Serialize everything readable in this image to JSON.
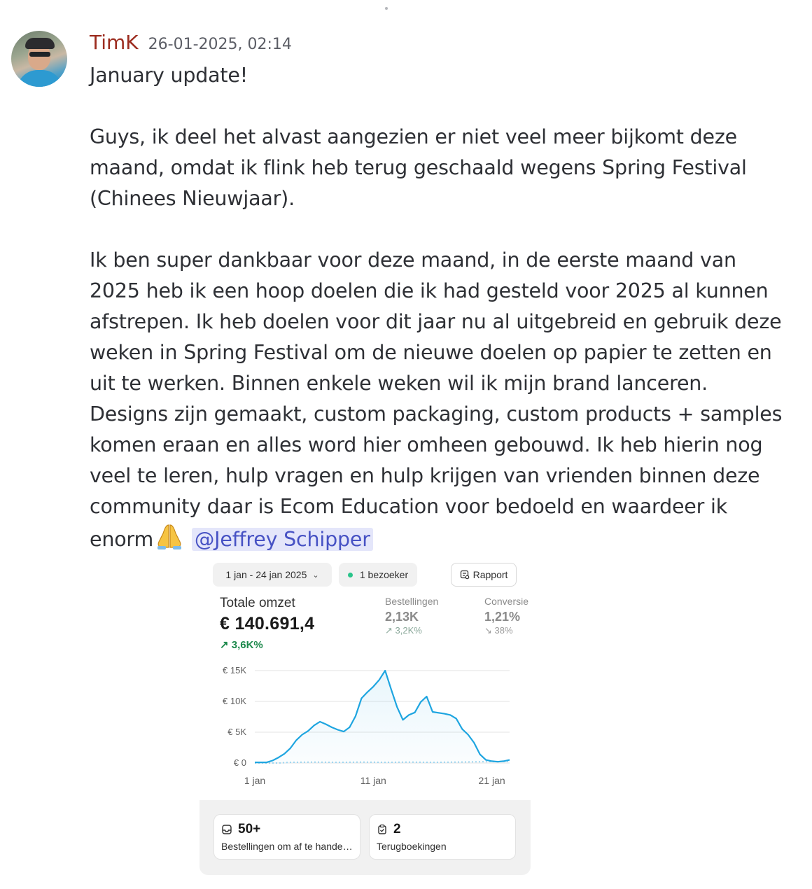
{
  "post": {
    "author": "TimK",
    "timestamp": "26-01-2025, 02:14",
    "paragraphs": {
      "p1": "January update!",
      "p2": "Guys, ik deel het alvast aangezien er niet veel meer bijkomt deze maand, omdat ik flink heb terug geschaald wegens Spring Festival (Chinees Nieuwjaar).",
      "p3": "Ik ben super dankbaar voor deze maand, in de eerste maand van 2025 heb ik een hoop doelen die ik had gesteld voor 2025 al kunnen afstrepen. Ik heb doelen voor dit jaar nu al uitgebreid en gebruik deze weken in Spring Festival om de nieuwe doelen op papier te zetten en uit te werken. Binnen enkele weken wil ik mijn brand lanceren. Designs zijn gemaakt, custom packaging, custom products + samples komen eraan en alles word hier omheen gebouwd. Ik heb hierin nog veel te leren, hulp vragen en hulp krijgen van vrienden binnen deze community daar is Ecom Education voor bedoeld en waardeer ik enorm"
    },
    "emoji": "folded-hands-emoji",
    "mention": "@Jeffrey Schipper",
    "colors": {
      "author": "#9c2c1f",
      "mention_bg": "#e4e6fa",
      "mention_text": "#4752c4"
    }
  },
  "dashboard": {
    "date_range": "1 jan - 24 jan 2025",
    "visitors": "1 bezoeker",
    "report_button": "Rapport",
    "total_sales": {
      "label": "Totale omzet",
      "value": "€ 140.691,4",
      "delta": "3,6K%"
    },
    "orders": {
      "label": "Bestellingen",
      "value": "2,13K",
      "delta": "3,2K%"
    },
    "conversion": {
      "label": "Conversie",
      "value": "1,21%",
      "delta": "38%"
    },
    "cards": {
      "to_fulfill": {
        "count": "50+",
        "label": "Bestellingen om af te handelen"
      },
      "chargebacks": {
        "count": "2",
        "label": "Terugboekingen"
      }
    }
  },
  "chart_data": {
    "type": "line",
    "y_tick_labels": [
      "€ 15K",
      "€ 10K",
      "€ 5K",
      "€ 0"
    ],
    "x_tick_labels": [
      "1 jan",
      "11 jan",
      "21 jan"
    ],
    "ylim": [
      0,
      15000
    ],
    "grid": true,
    "series": [
      {
        "color": "#1ea5e0",
        "values": [
          [
            0,
            100
          ],
          [
            1,
            100
          ],
          [
            1.5,
            400
          ],
          [
            2,
            900
          ],
          [
            2.5,
            1500
          ],
          [
            3,
            2400
          ],
          [
            3.5,
            3700
          ],
          [
            4,
            4600
          ],
          [
            4.5,
            5200
          ],
          [
            5,
            6100
          ],
          [
            5.5,
            6700
          ],
          [
            6,
            6300
          ],
          [
            6.5,
            5800
          ],
          [
            7,
            5400
          ],
          [
            7.5,
            5100
          ],
          [
            8,
            5800
          ],
          [
            8.5,
            7600
          ],
          [
            9,
            10500
          ],
          [
            9.5,
            11500
          ],
          [
            10,
            12400
          ],
          [
            10.5,
            13500
          ],
          [
            11,
            15000
          ],
          [
            11.5,
            12000
          ],
          [
            12,
            9100
          ],
          [
            12.5,
            7000
          ],
          [
            13,
            7800
          ],
          [
            13.5,
            8200
          ],
          [
            14,
            9900
          ],
          [
            14.5,
            10800
          ],
          [
            15,
            8300
          ],
          [
            16,
            8000
          ],
          [
            16.5,
            7800
          ],
          [
            17,
            7200
          ],
          [
            17.5,
            5500
          ],
          [
            18,
            4600
          ],
          [
            18.5,
            3300
          ],
          [
            19,
            1400
          ],
          [
            19.5,
            500
          ],
          [
            20,
            300
          ],
          [
            20.5,
            200
          ],
          [
            21,
            300
          ],
          [
            21.5,
            500
          ]
        ]
      },
      {
        "color": "#9dd5f0",
        "dashed": true,
        "values": [
          [
            0,
            0
          ],
          [
            2,
            0
          ],
          [
            3,
            100
          ],
          [
            5,
            150
          ],
          [
            7,
            100
          ],
          [
            9,
            150
          ],
          [
            11,
            100
          ],
          [
            13,
            150
          ],
          [
            15,
            100
          ],
          [
            17,
            150
          ],
          [
            19,
            200
          ],
          [
            21,
            250
          ],
          [
            21.5,
            300
          ]
        ]
      }
    ]
  }
}
